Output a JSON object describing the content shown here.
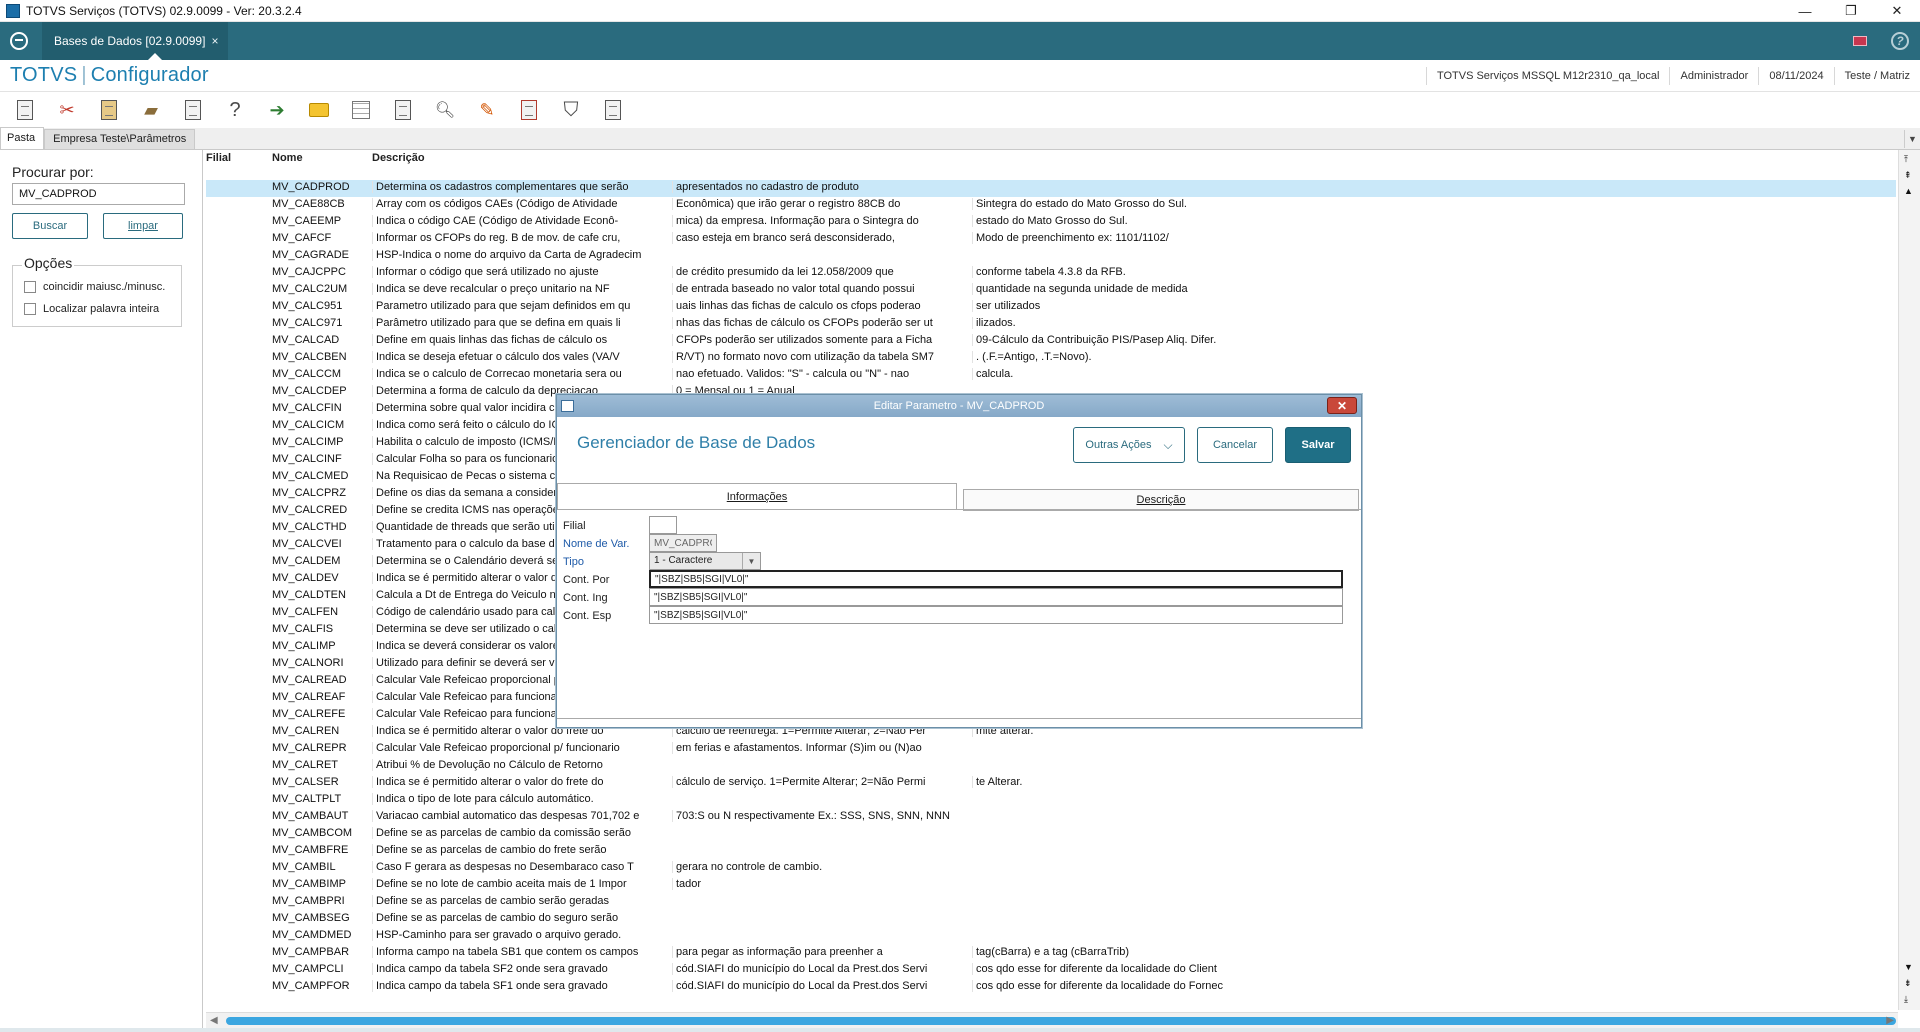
{
  "window": {
    "title": "TOTVS Serviços (TOTVS) 02.9.0099 - Ver: 20.3.2.4",
    "controls": [
      "—",
      "❐",
      "✕"
    ]
  },
  "tabbar": {
    "tab_label": "Bases de Dados [02.9.0099]",
    "tab_close": "×"
  },
  "header": {
    "brand": "TOTVS",
    "module": "Configurador",
    "environment": "TOTVS Serviços MSSQL M12r2310_qa_local",
    "user": "Administrador",
    "date": "08/11/2024",
    "branch": "Teste / Matriz"
  },
  "panel_tabs": {
    "pasta": "Pasta",
    "empresa": "Empresa Teste\\Parâmetros"
  },
  "search": {
    "label": "Procurar por:",
    "value": "MV_CADPROD",
    "search_button": "Buscar",
    "clear_button": "limpar",
    "options_title": "Opções",
    "option1": "coincidir maiusc./minusc.",
    "option2": "Localizar palavra inteira"
  },
  "table": {
    "columns": [
      "Filial",
      "Nome",
      "Descrição"
    ],
    "rows": [
      {
        "var": "MV_CADPROD",
        "d1": "Determina os cadastros complementares que serão",
        "d2": "apresentados no cadastro de produto",
        "d3": ""
      },
      {
        "var": "MV_CAE88CB",
        "d1": "Array com os códigos CAEs (Código de Atividade",
        "d2": "Econômica) que irão gerar o registro 88CB do",
        "d3": "Sintegra do estado do Mato Grosso do Sul."
      },
      {
        "var": "MV_CAEEMP",
        "d1": "Indica o código CAE (Código de Atividade Econô-",
        "d2": "mica) da empresa. Informação para o Sintegra do",
        "d3": "estado do Mato Grosso do Sul."
      },
      {
        "var": "MV_CAFCF",
        "d1": "Informar os CFOPs do reg. B de mov. de cafe cru,",
        "d2": "caso esteja em branco será desconsiderado,",
        "d3": "Modo de preenchimento ex: 1101/1102/"
      },
      {
        "var": "MV_CAGRADE",
        "d1": "HSP-Indica o nome do arquivo da Carta de Agradecim",
        "d2": "",
        "d3": ""
      },
      {
        "var": "MV_CAJCPPC",
        "d1": "Informar o código que será utilizado no ajuste",
        "d2": "de crédito presumido da lei 12.058/2009 que",
        "d3": "conforme tabela 4.3.8 da RFB."
      },
      {
        "var": "MV_CALC2UM",
        "d1": "Indica se deve recalcular o preço unitario na NF",
        "d2": "de entrada baseado no valor total quando possui",
        "d3": "quantidade na segunda unidade de medida"
      },
      {
        "var": "MV_CALC951",
        "d1": "Parametro utilizado para que sejam definidos em qu",
        "d2": "uais linhas das fichas de calculo os cfops poderao",
        "d3": " ser utilizados"
      },
      {
        "var": "MV_CALC971",
        "d1": "Parâmetro utilizado para que se defina em quais li",
        "d2": "nhas das fichas de cálculo os CFOPs poderão ser ut",
        "d3": "ilizados."
      },
      {
        "var": "MV_CALCAD",
        "d1": "Define em quais linhas das fichas de cálculo os",
        "d2": "CFOPs poderão ser utilizados somente para a Ficha",
        "d3": "09-Cálculo da Contribuição PIS/Pasep Aliq. Difer."
      },
      {
        "var": "MV_CALCBEN",
        "d1": "Indica se deseja efetuar o cálculo dos vales (VA/V",
        "d2": "R/VT) no formato novo com utilização da tabela SM7",
        "d3": ". (.F.=Antigo, .T.=Novo)."
      },
      {
        "var": "MV_CALCCM",
        "d1": "Indica se o calculo de Correcao monetaria sera ou",
        "d2": "nao efetuado. Validos: \"S\" - calcula ou \"N\" - nao",
        "d3": "calcula."
      },
      {
        "var": "MV_CALCDEP",
        "d1": "Determina a forma de calculo da depreciacao",
        "d2": "0 = Mensal ou 1 = Anual",
        "d3": ""
      },
      {
        "var": "MV_CALCFIN",
        "d1": "Determina sobre qual valor incidira ca",
        "d2": "",
        "d3": ""
      },
      {
        "var": "MV_CALCICM",
        "d1": "Indica como será feito o cálculo do ICM",
        "d2": "",
        "d3": ""
      },
      {
        "var": "MV_CALCIMP",
        "d1": "Habilita o calculo de imposto (ICMS/ISS",
        "d2": "",
        "d3": ""
      },
      {
        "var": "MV_CALCINF",
        "d1": "Calcular Folha so para os funcionarios",
        "d2": "",
        "d3": ""
      },
      {
        "var": "MV_CALCMED",
        "d1": "Na Requisicao de Pecas o sistema ca",
        "d2": "",
        "d3": ""
      },
      {
        "var": "MV_CALCPRZ",
        "d1": "Define os dias da semana a considera",
        "d2": "",
        "d3": ""
      },
      {
        "var": "MV_CALCRED",
        "d1": "Define se credita ICMS nas operações",
        "d2": "",
        "d3": ""
      },
      {
        "var": "MV_CALCTHD",
        "d1": "Quantidade de threads que serão utili",
        "d2": "",
        "d3": ""
      },
      {
        "var": "MV_CALCVEI",
        "d1": "Tratamento para o calculo da base do",
        "d2": "",
        "d3": ""
      },
      {
        "var": "MV_CALDEM",
        "d1": "Determina se o Calendário deverá ser",
        "d2": "",
        "d3": ""
      },
      {
        "var": "MV_CALDEV",
        "d1": "Indica se é permitido alterar o valor de",
        "d2": "",
        "d3": ""
      },
      {
        "var": "MV_CALDTEN",
        "d1": "Calcula a Dt de Entrega do Veiculo na",
        "d2": "",
        "d3": ""
      },
      {
        "var": "MV_CALFEN",
        "d1": "Código de calendário usado para calc",
        "d2": "",
        "d3": ""
      },
      {
        "var": "MV_CALFIS",
        "d1": "Determina se deve ser utilizado o cale",
        "d2": "",
        "d3": ""
      },
      {
        "var": "MV_CALIMP",
        "d1": "Indica se deverá considerar os valore",
        "d2": "",
        "d3": ""
      },
      {
        "var": "MV_CALNORI",
        "d1": "Utilizado para definir se deverá ser ve",
        "d2": "",
        "d3": ""
      },
      {
        "var": "MV_CALREAD",
        "d1": "Calcular Vale Refeicao proporcional pa",
        "d2": "",
        "d3": ""
      },
      {
        "var": "MV_CALREAF",
        "d1": "Calcular Vale Refeicao para funcionar",
        "d2": "",
        "d3": ""
      },
      {
        "var": "MV_CALREFE",
        "d1": "Calcular Vale Refeicao para funcionar",
        "d2": "",
        "d3": ""
      },
      {
        "var": "MV_CALREN",
        "d1": "Indica se é permitido alterar o valor do frete do",
        "d2": "cálculo de reentrega. 1=Permite Alterar; 2=Não Per",
        "d3": "mite alterar."
      },
      {
        "var": "MV_CALREPR",
        "d1": "Calcular Vale Refeicao proporcional p/ funcionario",
        "d2": "em ferias e afastamentos. Informar (S)im ou (N)ao",
        "d3": ""
      },
      {
        "var": "MV_CALRET",
        "d1": "Atribui % de Devolução no Cálculo de Retorno",
        "d2": "",
        "d3": ""
      },
      {
        "var": "MV_CALSER",
        "d1": "Indica se é permitido alterar o valor do frete do",
        "d2": "cálculo de serviço. 1=Permite Alterar; 2=Não Permi",
        "d3": "te Alterar."
      },
      {
        "var": "MV_CALTPLT",
        "d1": "Indica o tipo de lote para cálculo automático.",
        "d2": "",
        "d3": ""
      },
      {
        "var": "MV_CAMBAUT",
        "d1": "Variacao cambial automatico das despesas 701,702 e",
        "d2": "703:S ou N respectivamente Ex.: SSS, SNS, SNN, NNN",
        "d3": ""
      },
      {
        "var": "MV_CAMBCOM",
        "d1": "Define se as parcelas de cambio da comissão serão",
        "d2": "",
        "d3": ""
      },
      {
        "var": "MV_CAMBFRE",
        "d1": "Define se as parcelas de cambio do frete serão",
        "d2": "",
        "d3": ""
      },
      {
        "var": "MV_CAMBIL",
        "d1": "Caso F gerara as despesas no Desembaraco caso T",
        "d2": "gerara no controle de cambio.",
        "d3": ""
      },
      {
        "var": "MV_CAMBIMP",
        "d1": "Define se no lote de cambio aceita mais de 1 Impor",
        "d2": "tador",
        "d3": ""
      },
      {
        "var": "MV_CAMBPRI",
        "d1": "Define se as parcelas de cambio serão geradas",
        "d2": "",
        "d3": ""
      },
      {
        "var": "MV_CAMBSEG",
        "d1": "Define se as parcelas de cambio do seguro serão",
        "d2": "",
        "d3": ""
      },
      {
        "var": "MV_CAMDMED",
        "d1": "HSP-Caminho para ser gravado o arquivo gerado.",
        "d2": "",
        "d3": ""
      },
      {
        "var": "MV_CAMPBAR",
        "d1": "Informa campo na tabela SB1 que contem os campos",
        "d2": "para pegar as informação para preenher a",
        "d3": "tag(cBarra) e a tag (cBarraTrib)"
      },
      {
        "var": "MV_CAMPCLI",
        "d1": "Indica campo da tabela SF2  onde sera gravado",
        "d2": "cód.SIAFI do município do Local da Prest.dos Servi",
        "d3": "cos qdo esse for diferente da localidade do Client"
      },
      {
        "var": "MV_CAMPFOR",
        "d1": "Indica campo da tabela SF1 onde sera gravado",
        "d2": "cód.SIAFI do município do Local da Prest.dos Servi",
        "d3": "cos qdo esse for diferente da localidade do Fornec"
      }
    ]
  },
  "dialog": {
    "title": "Editar Parametro - MV_CADPROD",
    "heading": "Gerenciador de Base de Dados",
    "other_actions": "Outras Ações",
    "cancel": "Cancelar",
    "save": "Salvar",
    "tab_info": "Informações",
    "tab_desc": "Descrição",
    "fields": {
      "filial_label": "Filial",
      "filial_value": "",
      "var_label": "Nome de Var.",
      "var_value": "MV_CADPRC",
      "tipo_label": "Tipo",
      "tipo_value": "1 - Caractere",
      "por_label": "Cont. Por",
      "por_value": "\"|SBZ|SB5|SGI|VL0|\"",
      "ing_label": "Cont. Ing",
      "ing_value": "\"|SBZ|SB5|SGI|VL0|\"",
      "esp_label": "Cont. Esp",
      "esp_value": "\"|SBZ|SB5|SGI|VL0|\""
    }
  },
  "colors": {
    "teal": "#2a6b7e",
    "brand_blue": "#1d7fb0",
    "selection": "#c9e8f9",
    "save_button": "#1f6f86"
  }
}
